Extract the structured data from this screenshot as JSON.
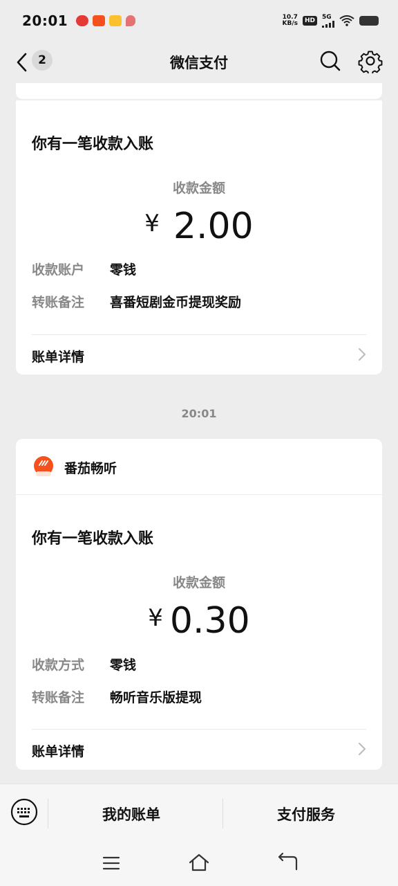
{
  "status": {
    "time": "20:01",
    "net_speed_value": "10.7",
    "net_speed_unit": "KB/s",
    "hd": "HD",
    "network": "5G",
    "app_colors": [
      "#e53935",
      "#f4511e",
      "#fbc02d",
      "#e57373"
    ]
  },
  "nav": {
    "back_count": "2",
    "title": "微信支付"
  },
  "cards": [
    {
      "title": "你有一笔收款入账",
      "amount_label": "收款金额",
      "currency": "¥",
      "amount": "2.00",
      "rows": [
        {
          "label": "收款账户",
          "value": "零钱"
        },
        {
          "label": "转账备注",
          "value": "喜番短剧金币提现奖励"
        }
      ],
      "detail_label": "账单详情"
    },
    {
      "sender": "番茄畅听",
      "title": "你有一笔收款入账",
      "amount_label": "收款金额",
      "currency": "¥",
      "amount": "0.30",
      "rows": [
        {
          "label": "收款方式",
          "value": "零钱"
        },
        {
          "label": "转账备注",
          "value": "畅听音乐版提现"
        }
      ],
      "detail_label": "账单详情"
    }
  ],
  "time_divider": "20:01",
  "bottom_tabs": {
    "my_bill": "我的账单",
    "pay_service": "支付服务"
  },
  "colors": {
    "background": "#ededed",
    "card": "#ffffff",
    "muted_text": "#888888",
    "sender_logo": "#f4511e"
  }
}
